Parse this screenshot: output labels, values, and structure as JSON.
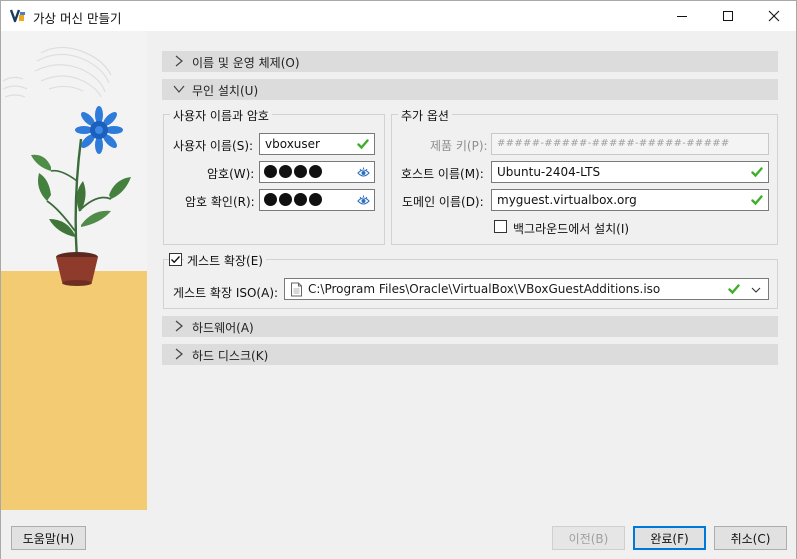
{
  "window": {
    "title": "가상 머신 만들기"
  },
  "sections": {
    "name_os": "이름 및 운영 체제(O)",
    "unattended": "무인 설치(U)",
    "hardware": "하드웨어(A)",
    "hard_disk": "하드 디스크(K)"
  },
  "user_group": {
    "title": "사용자 이름과 암호",
    "username_label": "사용자 이름(S):",
    "username_value": "vboxuser",
    "password_label": "암호(W):",
    "password_confirm_label": "암호 확인(R):"
  },
  "extra_group": {
    "title": "추가 옵션",
    "product_key_label": "제품 키(P):",
    "product_key_value": "#####-#####-#####-#####-#####",
    "hostname_label": "호스트 이름(M):",
    "hostname_value": "Ubuntu-2404-LTS",
    "domain_label": "도메인 이름(D):",
    "domain_value": "myguest.virtualbox.org",
    "background_install_label": "백그라운드에서 설치(I)",
    "background_install_checked": false
  },
  "guest_additions": {
    "checkbox_label": "게스트 확장(E)",
    "checked": true,
    "iso_label": "게스트 확장 ISO(A):",
    "iso_value": "C:\\Program Files\\Oracle\\VirtualBox\\VBoxGuestAdditions.iso"
  },
  "footer": {
    "help": "도움말(H)",
    "back": "이전(B)",
    "finish": "완료(F)",
    "cancel": "취소(C)"
  },
  "colors": {
    "ok_green": "#3fae2a",
    "accent": "#0078d7",
    "section_bg": "#dcdcdc"
  },
  "icons": {
    "app": "virtualbox-icon",
    "ok": "checkmark-icon",
    "eye": "show-password-icon",
    "file": "file-icon",
    "dropdown": "chevron-down-icon"
  }
}
